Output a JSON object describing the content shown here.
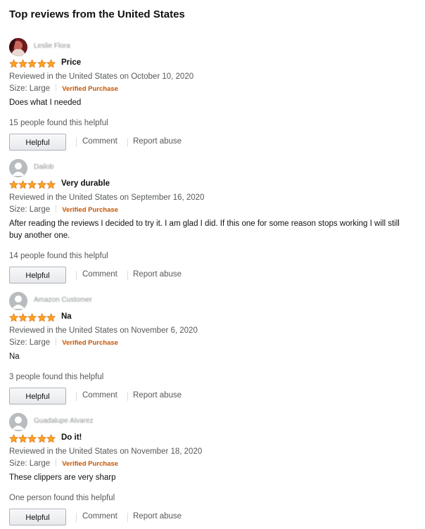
{
  "section": {
    "title": "Top reviews from the United States"
  },
  "colors": {
    "star": "#FFA41C",
    "verified": "#C45500",
    "muted": "#565959"
  },
  "reviews": [
    {
      "reviewer": "Leslie Flora",
      "rating": 5,
      "title": "Price",
      "date_line": "Reviewed in the United States on October 10, 2020",
      "size": "Size: Large",
      "verified": "Verified Purchase",
      "body": "Does what I needed",
      "helpful_count": "15 people found this helpful",
      "actions": {
        "helpful": "Helpful",
        "comment": "Comment",
        "report": "Report abuse"
      }
    },
    {
      "reviewer": "Dailob",
      "rating": 5,
      "title": "Very durable",
      "date_line": "Reviewed in the United States on September 16, 2020",
      "size": "Size: Large",
      "verified": "Verified Purchase",
      "body": "After reading the reviews I decided to try it. I am glad I did. If this one for some reason stops working I will still buy another one.",
      "helpful_count": "14 people found this helpful",
      "actions": {
        "helpful": "Helpful",
        "comment": "Comment",
        "report": "Report abuse"
      }
    },
    {
      "reviewer": "Amazon Customer",
      "rating": 5,
      "title": "Na",
      "date_line": "Reviewed in the United States on November 6, 2020",
      "size": "Size: Large",
      "verified": "Verified Purchase",
      "body": "Na",
      "helpful_count": "3 people found this helpful",
      "actions": {
        "helpful": "Helpful",
        "comment": "Comment",
        "report": "Report abuse"
      }
    },
    {
      "reviewer": "Guadalupe Alvarez",
      "rating": 5,
      "title": "Do it!",
      "date_line": "Reviewed in the United States on November 18, 2020",
      "size": "Size: Large",
      "verified": "Verified Purchase",
      "body": "These clippers are very sharp",
      "helpful_count": "One person found this helpful",
      "actions": {
        "helpful": "Helpful",
        "comment": "Comment",
        "report": "Report abuse"
      }
    }
  ]
}
